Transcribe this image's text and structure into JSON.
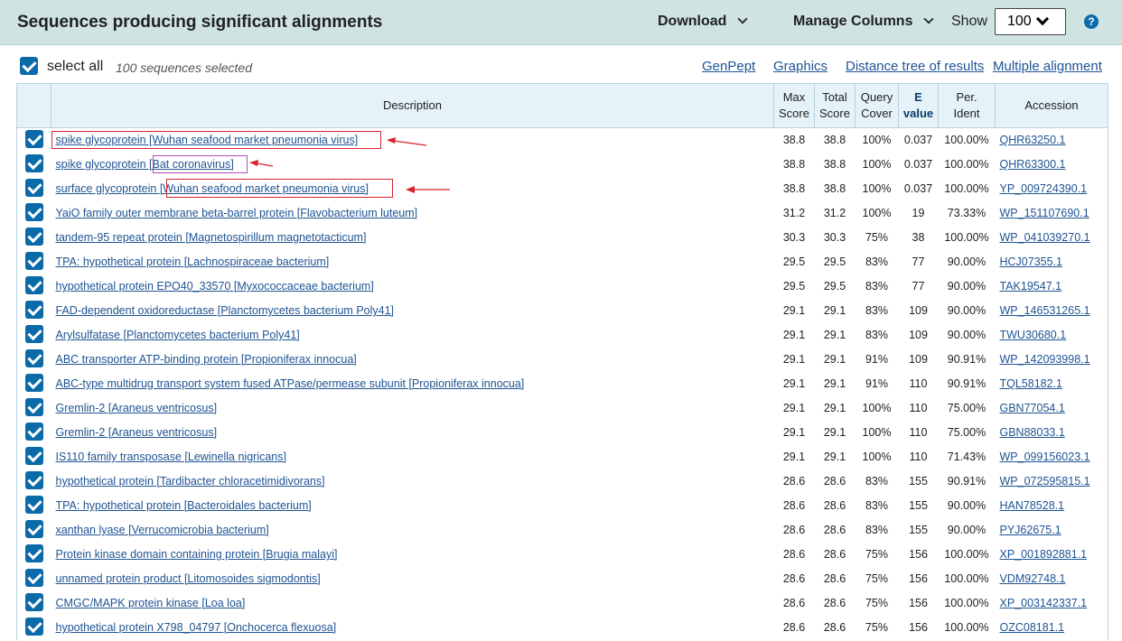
{
  "header": {
    "title": "Sequences producing significant alignments",
    "download_label": "Download",
    "manage_columns_label": "Manage Columns",
    "show_label": "Show",
    "show_value": "100",
    "help_glyph": "?"
  },
  "toolbar": {
    "select_all_label": "select all",
    "selected_count": "100 sequences selected",
    "links": [
      "GenPept",
      "Graphics",
      "Distance tree of results",
      "Multiple alignment"
    ]
  },
  "table": {
    "columns": {
      "description": "Description",
      "max_score": [
        "Max",
        "Score"
      ],
      "total_score": [
        "Total",
        "Score"
      ],
      "query_cover": [
        "Query",
        "Cover"
      ],
      "e_value": [
        "E",
        "value"
      ],
      "per_ident": [
        "Per.",
        "Ident"
      ],
      "accession": "Accession"
    },
    "rows": [
      {
        "desc": "spike glycoprotein [Wuhan seafood market pneumonia virus]",
        "max": "38.8",
        "total": "38.8",
        "cover": "100%",
        "e": "0.037",
        "ident": "100.00%",
        "acc": "QHR63250.1"
      },
      {
        "desc": "spike glycoprotein [Bat coronavirus]",
        "max": "38.8",
        "total": "38.8",
        "cover": "100%",
        "e": "0.037",
        "ident": "100.00%",
        "acc": "QHR63300.1"
      },
      {
        "desc": "surface glycoprotein [Wuhan seafood market pneumonia virus]",
        "max": "38.8",
        "total": "38.8",
        "cover": "100%",
        "e": "0.037",
        "ident": "100.00%",
        "acc": "YP_009724390.1"
      },
      {
        "desc": "YaiO family outer membrane beta-barrel protein [Flavobacterium luteum]",
        "max": "31.2",
        "total": "31.2",
        "cover": "100%",
        "e": "19",
        "ident": "73.33%",
        "acc": "WP_151107690.1"
      },
      {
        "desc": "tandem-95 repeat protein [Magnetospirillum magnetotacticum]",
        "max": "30.3",
        "total": "30.3",
        "cover": "75%",
        "e": "38",
        "ident": "100.00%",
        "acc": "WP_041039270.1"
      },
      {
        "desc": "TPA: hypothetical protein [Lachnospiraceae bacterium]",
        "max": "29.5",
        "total": "29.5",
        "cover": "83%",
        "e": "77",
        "ident": "90.00%",
        "acc": "HCJ07355.1"
      },
      {
        "desc": "hypothetical protein EPO40_33570 [Myxococcaceae bacterium]",
        "max": "29.5",
        "total": "29.5",
        "cover": "83%",
        "e": "77",
        "ident": "90.00%",
        "acc": "TAK19547.1"
      },
      {
        "desc": "FAD-dependent oxidoreductase [Planctomycetes bacterium Poly41]",
        "max": "29.1",
        "total": "29.1",
        "cover": "83%",
        "e": "109",
        "ident": "90.00%",
        "acc": "WP_146531265.1"
      },
      {
        "desc": "Arylsulfatase [Planctomycetes bacterium Poly41]",
        "max": "29.1",
        "total": "29.1",
        "cover": "83%",
        "e": "109",
        "ident": "90.00%",
        "acc": "TWU30680.1"
      },
      {
        "desc": "ABC transporter ATP-binding protein [Propioniferax innocua]",
        "max": "29.1",
        "total": "29.1",
        "cover": "91%",
        "e": "109",
        "ident": "90.91%",
        "acc": "WP_142093998.1"
      },
      {
        "desc": "ABC-type multidrug transport system fused ATPase/permease subunit [Propioniferax innocua]",
        "max": "29.1",
        "total": "29.1",
        "cover": "91%",
        "e": "110",
        "ident": "90.91%",
        "acc": "TQL58182.1"
      },
      {
        "desc": "Gremlin-2 [Araneus ventricosus]",
        "max": "29.1",
        "total": "29.1",
        "cover": "100%",
        "e": "110",
        "ident": "75.00%",
        "acc": "GBN77054.1"
      },
      {
        "desc": "Gremlin-2 [Araneus ventricosus]",
        "max": "29.1",
        "total": "29.1",
        "cover": "100%",
        "e": "110",
        "ident": "75.00%",
        "acc": "GBN88033.1"
      },
      {
        "desc": "IS110 family transposase [Lewinella nigricans]",
        "max": "29.1",
        "total": "29.1",
        "cover": "100%",
        "e": "110",
        "ident": "71.43%",
        "acc": "WP_099156023.1"
      },
      {
        "desc": "hypothetical protein [Tardibacter chloracetimidivorans]",
        "max": "28.6",
        "total": "28.6",
        "cover": "83%",
        "e": "155",
        "ident": "90.91%",
        "acc": "WP_072595815.1"
      },
      {
        "desc": "TPA: hypothetical protein [Bacteroidales bacterium]",
        "max": "28.6",
        "total": "28.6",
        "cover": "83%",
        "e": "155",
        "ident": "90.00%",
        "acc": "HAN78528.1"
      },
      {
        "desc": "xanthan lyase [Verrucomicrobia bacterium]",
        "max": "28.6",
        "total": "28.6",
        "cover": "83%",
        "e": "155",
        "ident": "90.00%",
        "acc": "PYJ62675.1"
      },
      {
        "desc": "Protein kinase domain containing protein [Brugia malayi]",
        "max": "28.6",
        "total": "28.6",
        "cover": "75%",
        "e": "156",
        "ident": "100.00%",
        "acc": "XP_001892881.1"
      },
      {
        "desc": "unnamed protein product [Litomosoides sigmodontis]",
        "max": "28.6",
        "total": "28.6",
        "cover": "75%",
        "e": "156",
        "ident": "100.00%",
        "acc": "VDM92748.1"
      },
      {
        "desc": "CMGC/MAPK protein kinase [Loa loa]",
        "max": "28.6",
        "total": "28.6",
        "cover": "75%",
        "e": "156",
        "ident": "100.00%",
        "acc": "XP_003142337.1"
      },
      {
        "desc": "hypothetical protein X798_04797 [Onchocerca flexuosa]",
        "max": "28.6",
        "total": "28.6",
        "cover": "75%",
        "e": "156",
        "ident": "100.00%",
        "acc": "OZC08181.1"
      }
    ]
  },
  "colors": {
    "header_bg": "#cfe3e3",
    "link": "#205493",
    "checkbox": "#0b6aa8",
    "annotation_red": "#d8232a",
    "annotation_purple": "#b54bb5"
  }
}
